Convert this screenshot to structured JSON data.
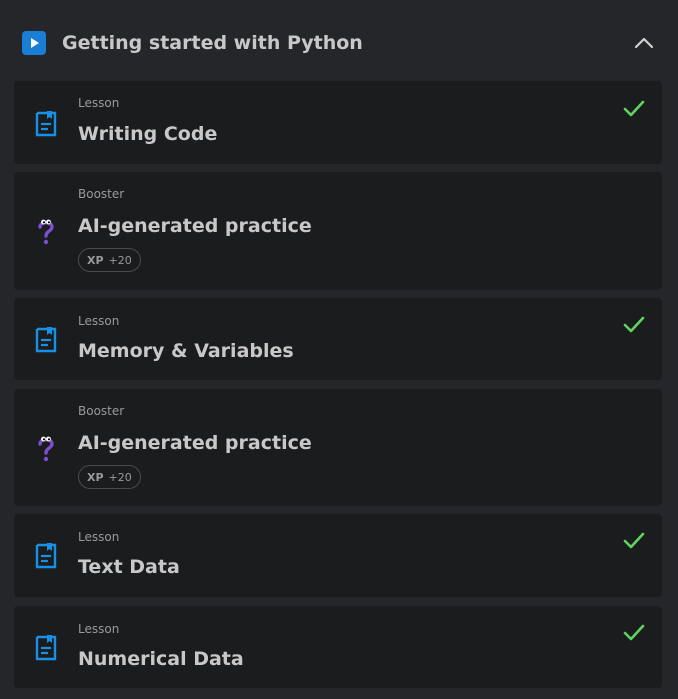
{
  "section": {
    "title": "Getting started with Python",
    "play_icon": "play-icon",
    "collapse_icon": "chevron-up-icon"
  },
  "colors": {
    "background": "#24262a",
    "card": "#1b1c1e",
    "accent_blue": "#1a7fd4",
    "check_green": "#5fd35f",
    "booster_purple": "#7b4fd0"
  },
  "items": [
    {
      "kind": "Lesson",
      "title": "Writing Code",
      "icon": "lesson-document-icon",
      "completed": true
    },
    {
      "kind": "Booster",
      "title": "AI-generated practice",
      "icon": "booster-question-icon",
      "xp_label": "XP",
      "xp_value": "+20"
    },
    {
      "kind": "Lesson",
      "title": "Memory & Variables",
      "icon": "lesson-document-icon",
      "completed": true
    },
    {
      "kind": "Booster",
      "title": "AI-generated practice",
      "icon": "booster-question-icon",
      "xp_label": "XP",
      "xp_value": "+20"
    },
    {
      "kind": "Lesson",
      "title": "Text Data",
      "icon": "lesson-document-icon",
      "completed": true
    },
    {
      "kind": "Lesson",
      "title": "Numerical Data",
      "icon": "lesson-document-icon",
      "completed": true
    }
  ]
}
